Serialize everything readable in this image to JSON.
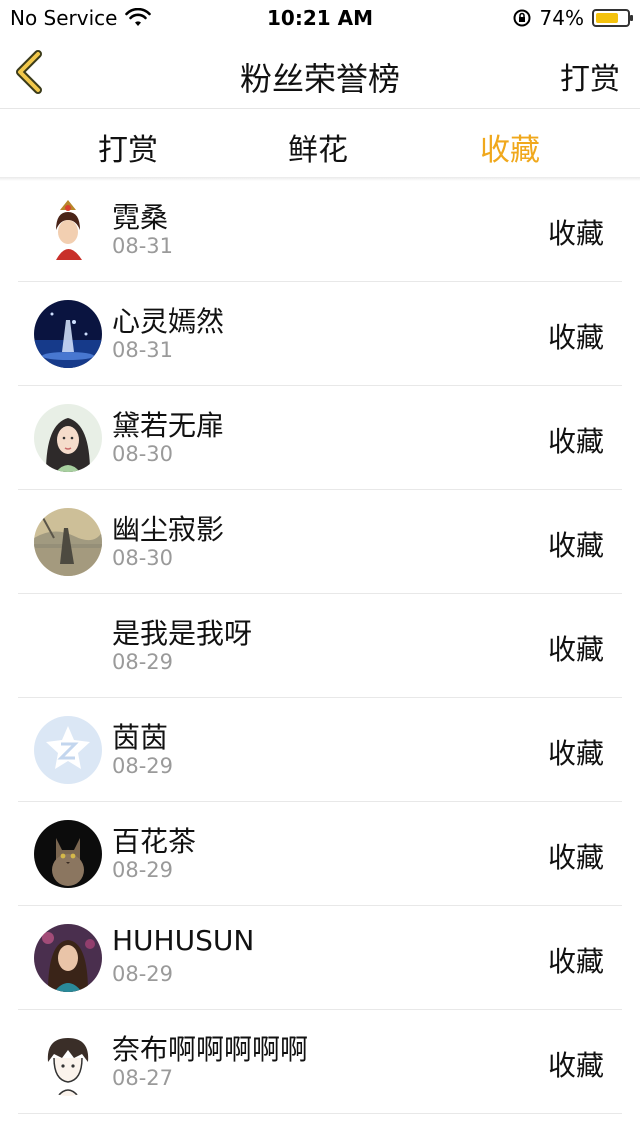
{
  "status": {
    "carrier": "No Service",
    "time": "10:21 AM",
    "battery": "74%",
    "battery_level": 0.74
  },
  "nav": {
    "title": "粉丝荣誉榜",
    "right": "打赏"
  },
  "tabs": [
    {
      "label": "打赏",
      "active": false
    },
    {
      "label": "鲜花",
      "active": false
    },
    {
      "label": "收藏",
      "active": true
    }
  ],
  "colors": {
    "accent": "#f0a81c"
  },
  "rows": [
    {
      "name": "霓桑",
      "date": "08-31",
      "action": "收藏",
      "avatar": "ancient-lady-avatar"
    },
    {
      "name": "心灵嫣然",
      "date": "08-31",
      "action": "收藏",
      "avatar": "night-sky-avatar"
    },
    {
      "name": "黛若无扉",
      "date": "08-30",
      "action": "收藏",
      "avatar": "girl-illustration-avatar"
    },
    {
      "name": "幽尘寂影",
      "date": "08-30",
      "action": "收藏",
      "avatar": "ink-landscape-avatar"
    },
    {
      "name": "是我是我呀",
      "date": "08-29",
      "action": "收藏",
      "avatar": "none"
    },
    {
      "name": "茵茵",
      "date": "08-29",
      "action": "收藏",
      "avatar": "qq-default-avatar"
    },
    {
      "name": "百花茶",
      "date": "08-29",
      "action": "收藏",
      "avatar": "cat-photo-avatar"
    },
    {
      "name": "HUHUSUN",
      "date": "08-29",
      "action": "收藏",
      "avatar": "woman-photo-avatar"
    },
    {
      "name": "奈布啊啊啊啊啊",
      "date": "08-27",
      "action": "收藏",
      "avatar": "anime-boy-avatar"
    }
  ]
}
